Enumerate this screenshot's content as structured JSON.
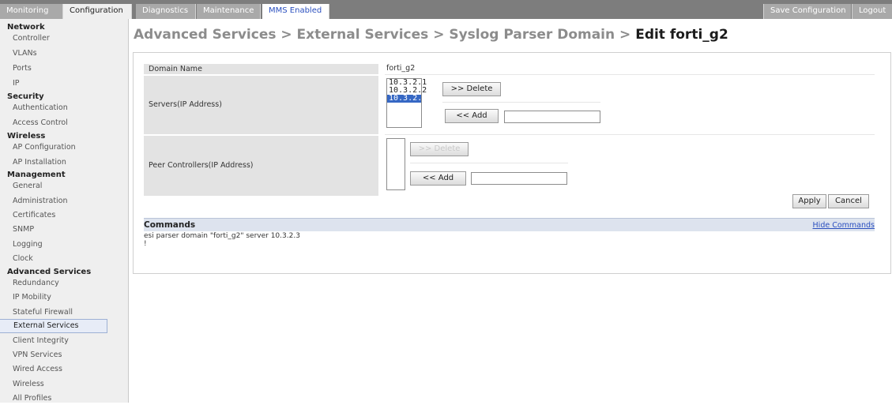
{
  "topbar": {
    "tabs": [
      "Monitoring",
      "Configuration",
      "Diagnostics",
      "Maintenance",
      "MMS Enabled"
    ],
    "save_label": "Save Configuration",
    "logout_label": "Logout"
  },
  "sidebar": {
    "network": {
      "title": "Network",
      "items": [
        "Controller",
        "VLANs",
        "Ports",
        "IP"
      ]
    },
    "security": {
      "title": "Security",
      "items": [
        "Authentication",
        "Access Control"
      ]
    },
    "wireless": {
      "title": "Wireless",
      "items": [
        "AP Configuration",
        "AP Installation"
      ]
    },
    "management": {
      "title": "Management",
      "items": [
        "General",
        "Administration",
        "Certificates",
        "SNMP",
        "Logging",
        "Clock"
      ]
    },
    "advanced": {
      "title": "Advanced Services",
      "items": [
        "Redundancy",
        "IP Mobility",
        "Stateful Firewall",
        "External Services",
        "Client Integrity",
        "VPN Services",
        "Wired Access",
        "Wireless",
        "All Profiles"
      ]
    }
  },
  "page": {
    "breadcrumb": "Advanced Services > External Services > Syslog Parser Domain > ",
    "title_strong": "Edit forti_g2"
  },
  "form": {
    "domain_label": "Domain Name",
    "domain_value": "forti_g2",
    "servers_label": "Servers(IP Address)",
    "servers": [
      "10.3.2.1",
      "10.3.2.2",
      "10.3.2.3"
    ],
    "selected_server": "10.3.2.3",
    "delete_label": ">> Delete",
    "add_label": "<< Add",
    "server_input": "",
    "peers_label": "Peer Controllers(IP Address)",
    "peers": [],
    "peer_input": "",
    "apply_label": "Apply",
    "cancel_label": "Cancel"
  },
  "commands": {
    "title": "Commands",
    "hide_label": "Hide Commands",
    "lines": [
      "esi parser domain \"forti_g2\" server 10.3.2.3",
      "!"
    ]
  }
}
